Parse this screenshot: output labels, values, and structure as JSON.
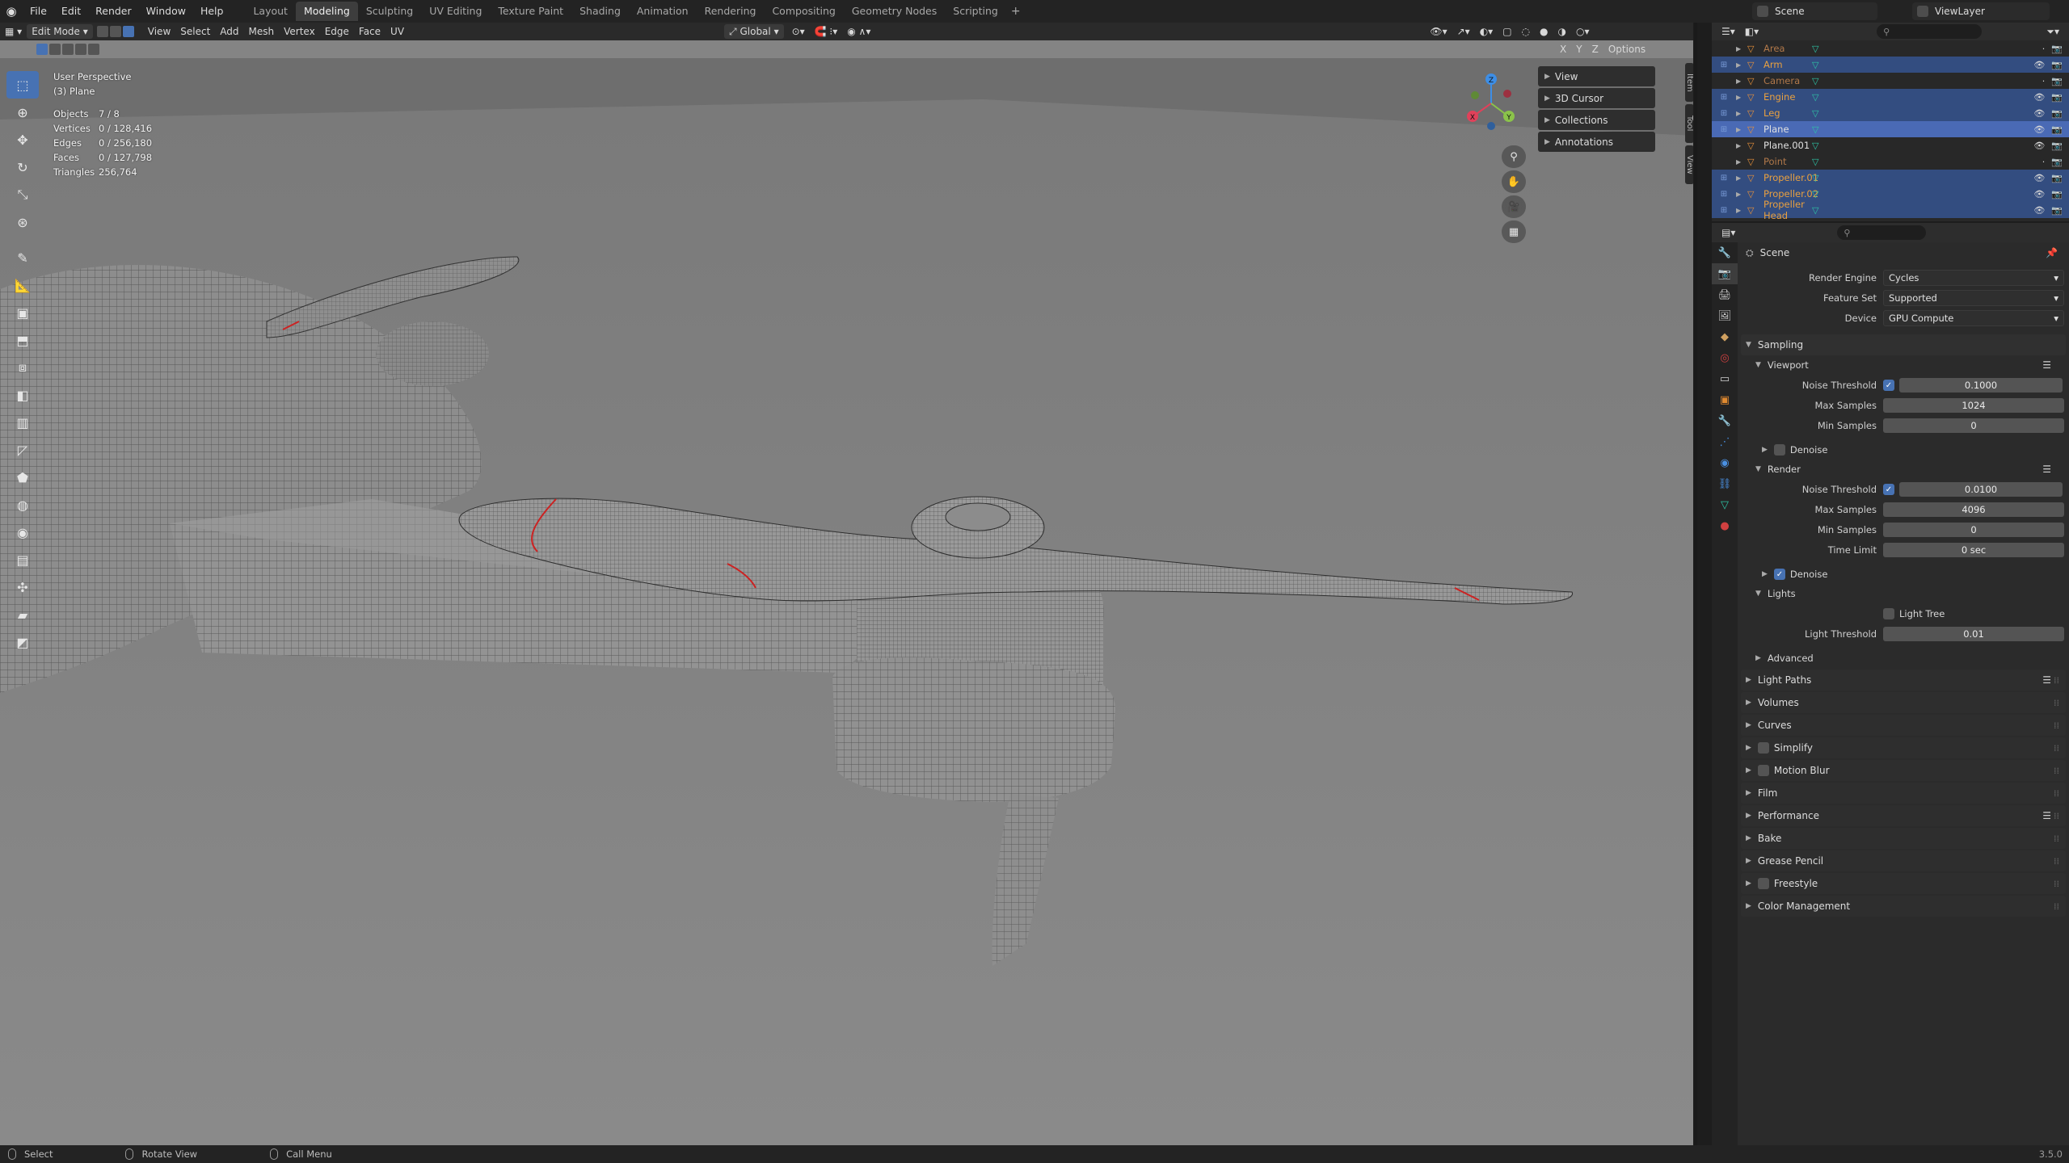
{
  "menu": [
    "File",
    "Edit",
    "Render",
    "Window",
    "Help"
  ],
  "workspaces": [
    "Layout",
    "Modeling",
    "Sculpting",
    "UV Editing",
    "Texture Paint",
    "Shading",
    "Animation",
    "Rendering",
    "Compositing",
    "Geometry Nodes",
    "Scripting"
  ],
  "active_workspace": "Modeling",
  "scene_name": "Scene",
  "view_layer": "ViewLayer",
  "viewport": {
    "mode": "Edit Mode",
    "menus": [
      "View",
      "Select",
      "Add",
      "Mesh",
      "Vertex",
      "Edge",
      "Face",
      "UV"
    ],
    "orientation": "Global",
    "options_label": "Options",
    "axes": [
      "X",
      "Y",
      "Z"
    ],
    "perspective": "User Perspective",
    "object_label": "(3) Plane",
    "stats": [
      {
        "label": "Objects",
        "value": "7 / 8"
      },
      {
        "label": "Vertices",
        "value": "0 / 128,416"
      },
      {
        "label": "Edges",
        "value": "0 / 256,180"
      },
      {
        "label": "Faces",
        "value": "0 / 127,798"
      },
      {
        "label": "Triangles",
        "value": "256,764"
      }
    ],
    "npanel_items": [
      "View",
      "3D Cursor",
      "Collections",
      "Annotations"
    ],
    "side_tabs": [
      "Item",
      "Tool",
      "View"
    ],
    "gizmo_axes": {
      "x": "X",
      "y": "Y",
      "z": "Z"
    },
    "colors": {
      "bg": "#848484",
      "mesh": "#8e8e8e",
      "wire": "#2b2b2b",
      "seam": "#cc2222",
      "x": "#e0415a",
      "y": "#8bc34a",
      "z": "#3d8ee6"
    }
  },
  "outliner": {
    "search_placeholder": "",
    "items": [
      {
        "name": "Area",
        "state": "faded",
        "eye": ""
      },
      {
        "name": "Arm",
        "state": "selected",
        "eye": "●"
      },
      {
        "name": "Camera",
        "state": "faded",
        "eye": ""
      },
      {
        "name": "Engine",
        "state": "selected",
        "eye": "●"
      },
      {
        "name": "Leg",
        "state": "selected",
        "eye": "●"
      },
      {
        "name": "Plane",
        "state": "active",
        "eye": "●"
      },
      {
        "name": "Plane.001",
        "state": "normal",
        "eye": "●"
      },
      {
        "name": "Point",
        "state": "faded",
        "eye": ""
      },
      {
        "name": "Propeller.01",
        "state": "selected",
        "eye": "●"
      },
      {
        "name": "Propeller.02",
        "state": "selected",
        "eye": "●"
      },
      {
        "name": "Propeller Head",
        "state": "selected",
        "eye": "●"
      }
    ]
  },
  "properties": {
    "context": "Scene",
    "render_engine_label": "Render Engine",
    "render_engine": "Cycles",
    "feature_set_label": "Feature Set",
    "feature_set": "Supported",
    "device_label": "Device",
    "device": "GPU Compute",
    "sampling": "Sampling",
    "viewport": "Viewport",
    "noise_threshold_label": "Noise Threshold",
    "vp_noise_threshold": "0.1000",
    "max_samples_label": "Max Samples",
    "vp_max_samples": "1024",
    "min_samples_label": "Min Samples",
    "vp_min_samples": "0",
    "denoise": "Denoise",
    "render": "Render",
    "r_noise_threshold": "0.0100",
    "r_max_samples": "4096",
    "r_min_samples": "0",
    "time_limit_label": "Time Limit",
    "time_limit": "0 sec",
    "lights": "Lights",
    "light_tree": "Light Tree",
    "light_threshold_label": "Light Threshold",
    "light_threshold": "0.01",
    "advanced": "Advanced",
    "sections": [
      {
        "label": "Light Paths",
        "checkbox": false,
        "list": true
      },
      {
        "label": "Volumes",
        "checkbox": false,
        "list": false
      },
      {
        "label": "Curves",
        "checkbox": false,
        "list": false
      },
      {
        "label": "Simplify",
        "checkbox": true,
        "list": false
      },
      {
        "label": "Motion Blur",
        "checkbox": true,
        "list": false
      },
      {
        "label": "Film",
        "checkbox": false,
        "list": false
      },
      {
        "label": "Performance",
        "checkbox": false,
        "list": true
      },
      {
        "label": "Bake",
        "checkbox": false,
        "list": false
      },
      {
        "label": "Grease Pencil",
        "checkbox": false,
        "list": false
      },
      {
        "label": "Freestyle",
        "checkbox": true,
        "list": false
      },
      {
        "label": "Color Management",
        "checkbox": false,
        "list": false
      }
    ]
  },
  "statusbar": {
    "select": "Select",
    "rotate": "Rotate View",
    "call_menu": "Call Menu",
    "version": "3.5.0"
  }
}
